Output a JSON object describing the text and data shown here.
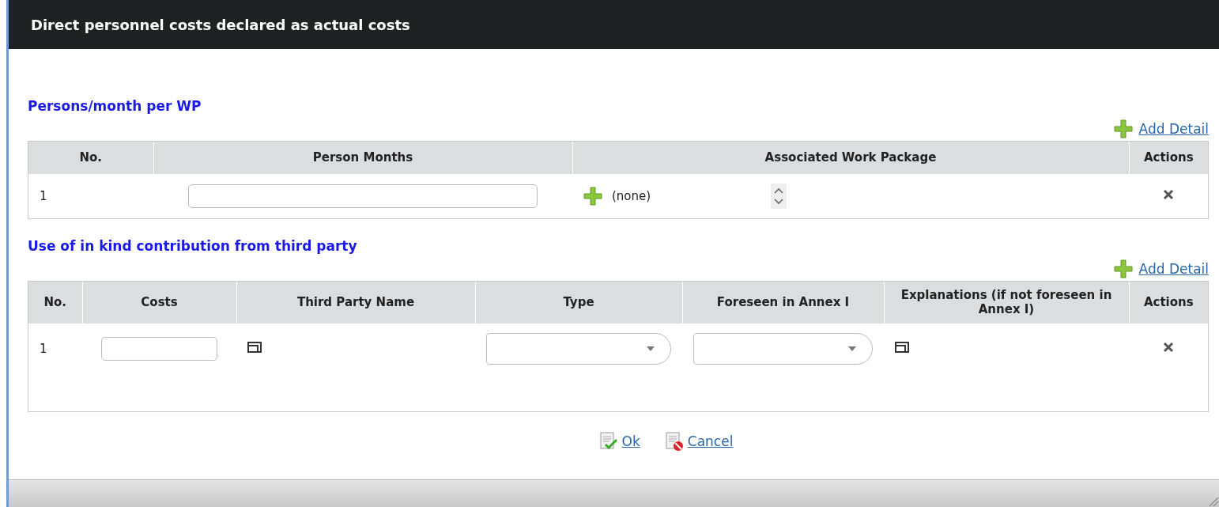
{
  "dialog": {
    "title": "Direct personnel costs declared as actual costs"
  },
  "sections": [
    {
      "heading": "Persons/month per WP",
      "add_link": "Add Detail",
      "columns": [
        "No.",
        "Person Months",
        "Associated Work Package",
        "Actions"
      ],
      "rows": [
        {
          "cells": [
            {
              "kind": "text",
              "text": "1"
            },
            {
              "kind": "input"
            },
            {
              "kind": "picker",
              "text": "(none)"
            },
            {
              "kind": "delete"
            }
          ]
        }
      ]
    },
    {
      "heading": "Use of in kind contribution from third party",
      "add_link": "Add Detail",
      "columns": [
        "No.",
        "Costs",
        "Third Party Name",
        "Type",
        "Foreseen in Annex I",
        "Explanations (if not foreseen in Annex I)",
        "Actions"
      ],
      "rows": [
        {
          "cells": [
            {
              "kind": "text",
              "text": "1"
            },
            {
              "kind": "input"
            },
            {
              "kind": "popup"
            },
            {
              "kind": "select"
            },
            {
              "kind": "select"
            },
            {
              "kind": "popup"
            },
            {
              "kind": "delete"
            }
          ]
        }
      ]
    }
  ],
  "buttons": [
    {
      "kind": "ok",
      "label": "Ok"
    },
    {
      "kind": "cancel",
      "label": "Cancel"
    }
  ]
}
